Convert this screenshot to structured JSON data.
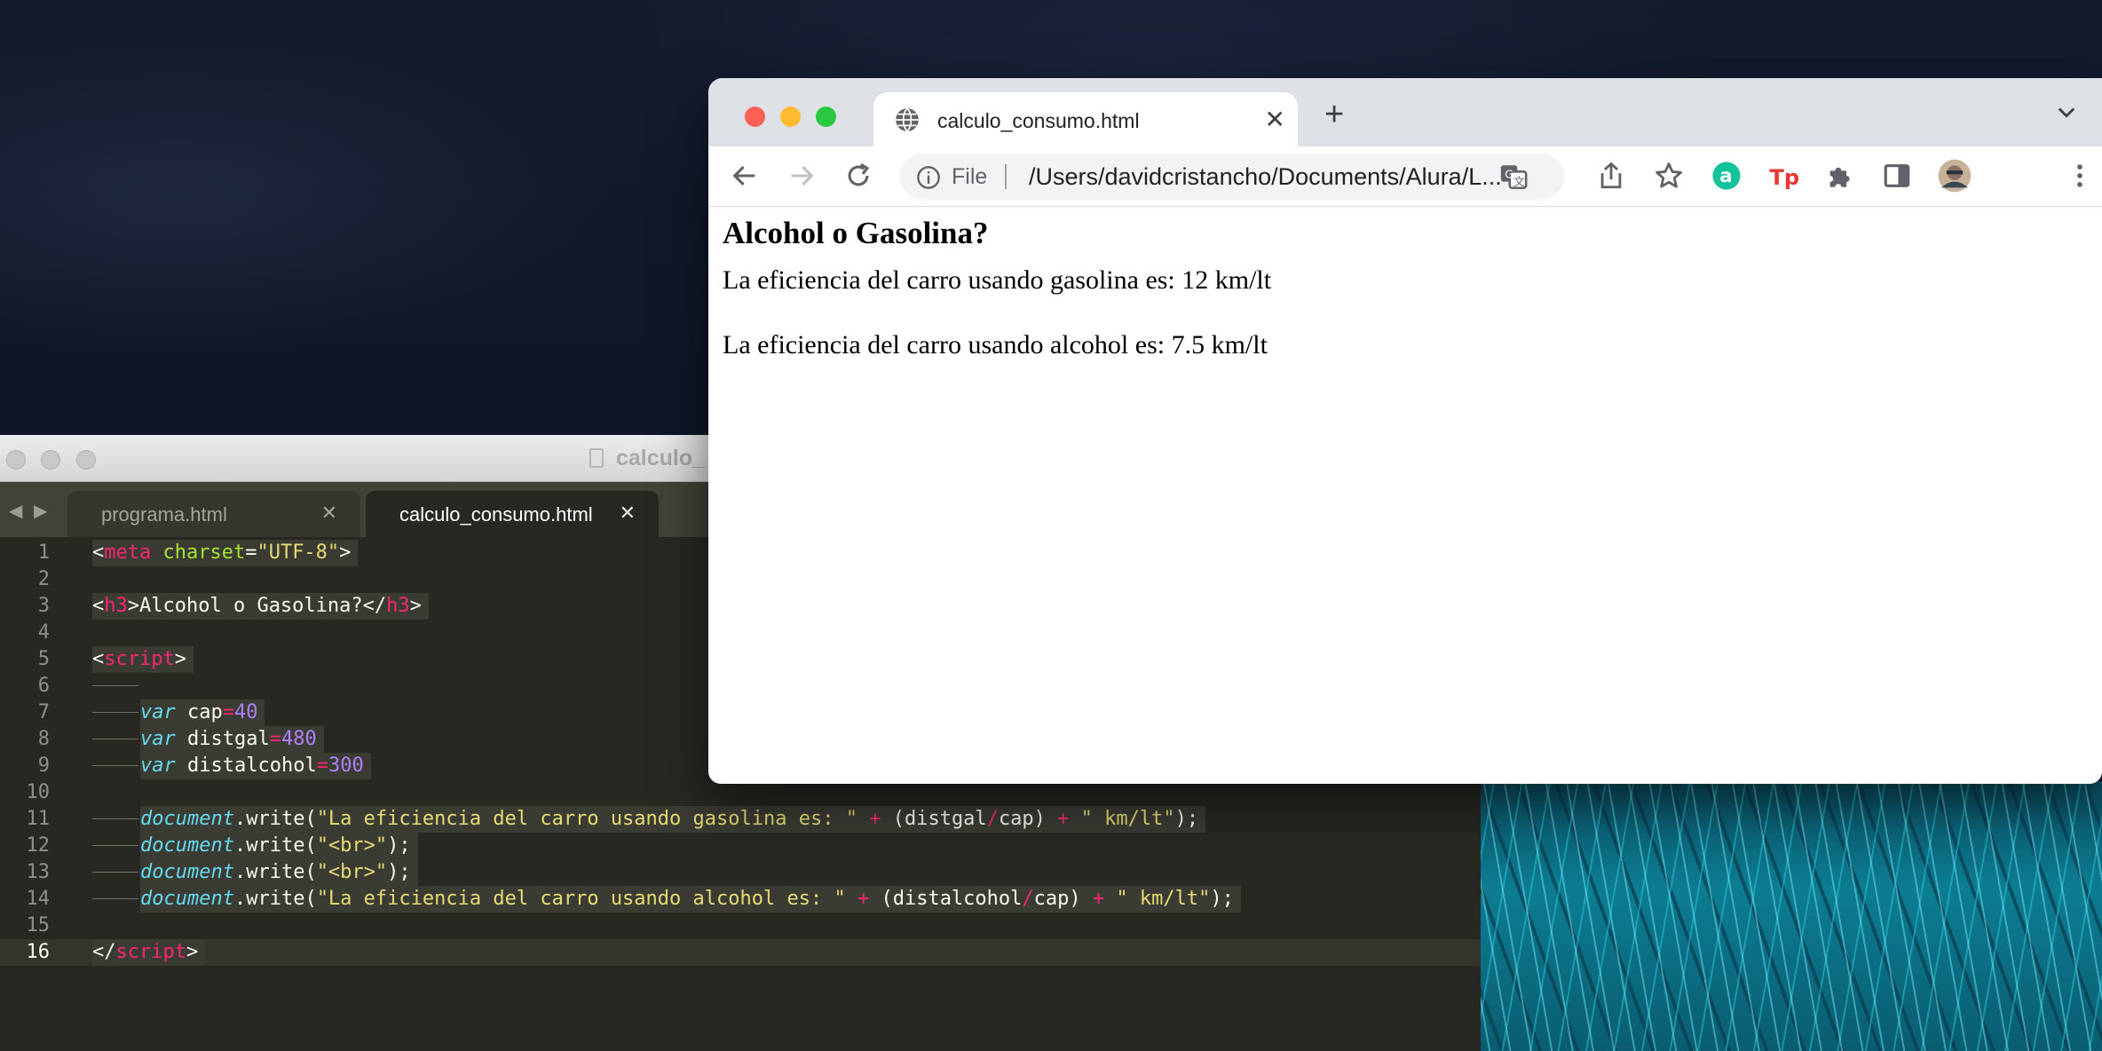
{
  "editor": {
    "window_title": "calculo_",
    "tabs": [
      {
        "label": "programa.html",
        "close": "✕",
        "active": false
      },
      {
        "label": "calculo_consumo.html",
        "close": "✕",
        "active": true
      }
    ],
    "current_line": 16,
    "lines": [
      {
        "n": "1",
        "segs": [
          [
            "",
            "<"
          ],
          [
            "kw",
            "meta"
          ],
          [
            "",
            " "
          ],
          [
            "at",
            "charset"
          ],
          [
            "",
            "="
          ],
          [
            "str",
            "\"UTF-8\""
          ],
          [
            "",
            ">"
          ]
        ]
      },
      {
        "n": "2",
        "segs": []
      },
      {
        "n": "3",
        "segs": [
          [
            "",
            "<"
          ],
          [
            "kw",
            "h3"
          ],
          [
            "",
            ">Alcohol o Gasolina?</"
          ],
          [
            "kw",
            "h3"
          ],
          [
            "",
            ">"
          ]
        ]
      },
      {
        "n": "4",
        "segs": []
      },
      {
        "n": "5",
        "segs": [
          [
            "",
            "<"
          ],
          [
            "kw",
            "script"
          ],
          [
            "",
            ">"
          ]
        ]
      },
      {
        "n": "6",
        "segs": [],
        "guide": true
      },
      {
        "n": "7",
        "segs": [
          [
            "it",
            "var"
          ],
          [
            "",
            " cap"
          ],
          [
            "op",
            "="
          ],
          [
            "num",
            "40"
          ]
        ],
        "indent": true
      },
      {
        "n": "8",
        "segs": [
          [
            "it",
            "var"
          ],
          [
            "",
            " distgal"
          ],
          [
            "op",
            "="
          ],
          [
            "num",
            "480"
          ]
        ],
        "indent": true
      },
      {
        "n": "9",
        "segs": [
          [
            "it",
            "var"
          ],
          [
            "",
            " distalcohol"
          ],
          [
            "op",
            "="
          ],
          [
            "num",
            "300"
          ]
        ],
        "indent": true
      },
      {
        "n": "10",
        "segs": []
      },
      {
        "n": "11",
        "segs": [
          [
            "it",
            "document"
          ],
          [
            "",
            ".write("
          ],
          [
            "str",
            "\"La eficiencia del carro usando gasolina es: \""
          ],
          [
            "",
            " "
          ],
          [
            "op",
            "+"
          ],
          [
            "",
            " (distgal"
          ],
          [
            "op",
            "/"
          ],
          [
            "",
            "cap) "
          ],
          [
            "op",
            "+"
          ],
          [
            "",
            " "
          ],
          [
            "str",
            "\" km/lt\""
          ],
          [
            "",
            ");"
          ]
        ],
        "indent": true
      },
      {
        "n": "12",
        "segs": [
          [
            "it",
            "document"
          ],
          [
            "",
            ".write("
          ],
          [
            "str",
            "\"<br>\""
          ],
          [
            "",
            ");"
          ]
        ],
        "indent": true
      },
      {
        "n": "13",
        "segs": [
          [
            "it",
            "document"
          ],
          [
            "",
            ".write("
          ],
          [
            "str",
            "\"<br>\""
          ],
          [
            "",
            ");"
          ]
        ],
        "indent": true
      },
      {
        "n": "14",
        "segs": [
          [
            "it",
            "document"
          ],
          [
            "",
            ".write("
          ],
          [
            "str",
            "\"La eficiencia del carro usando alcohol es: \""
          ],
          [
            "",
            " "
          ],
          [
            "op",
            "+"
          ],
          [
            "",
            " (distalcohol"
          ],
          [
            "op",
            "/"
          ],
          [
            "",
            "cap) "
          ],
          [
            "op",
            "+"
          ],
          [
            "",
            " "
          ],
          [
            "str",
            "\" km/lt\""
          ],
          [
            "",
            ");"
          ]
        ],
        "indent": true
      },
      {
        "n": "15",
        "segs": []
      },
      {
        "n": "16",
        "segs": [
          [
            "",
            "</"
          ],
          [
            "kw",
            "script"
          ],
          [
            "",
            ">"
          ]
        ]
      }
    ]
  },
  "browser": {
    "tab_title": "calculo_consumo.html",
    "tab_close": "✕",
    "new_tab": "+",
    "omnibox": {
      "scheme_label": "File",
      "url": "/Users/davidcristancho/Documents/Alura/L..."
    },
    "page": {
      "heading": "Alcohol o Gasolina?",
      "line1": "La eficiencia del carro usando gasolina es: 12 km/lt",
      "line2": "La eficiencia del carro usando alcohol es: 7.5 km/lt"
    }
  },
  "colors": {
    "editor_bg": "#272822",
    "keyword": "#f92672",
    "attribute": "#a6e22e",
    "string": "#e6db74",
    "number": "#ae81ff",
    "storage": "#66d9ef",
    "traffic_red": "#fe5f57",
    "traffic_yellow": "#febc2e",
    "traffic_green": "#28c840"
  }
}
